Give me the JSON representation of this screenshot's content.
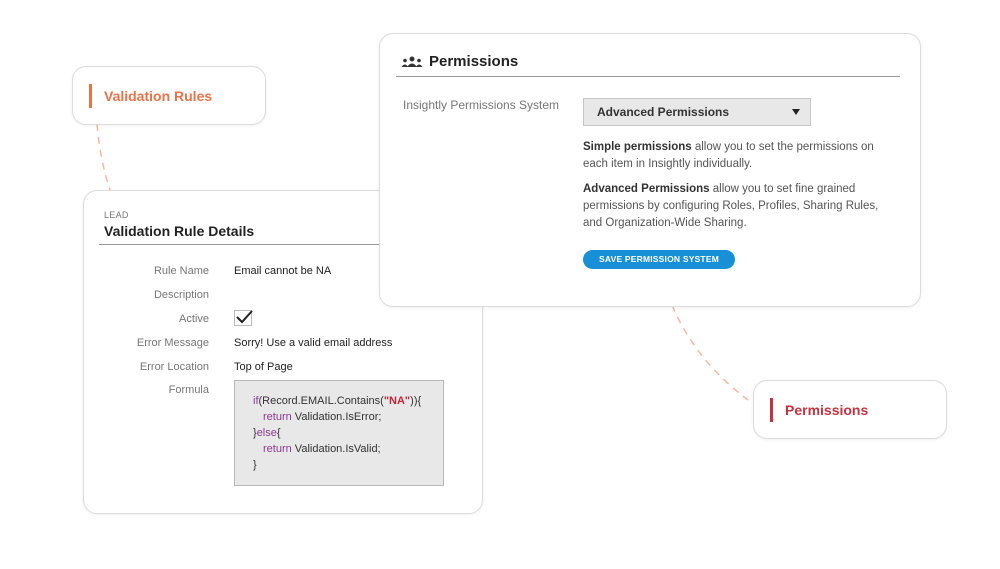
{
  "tags": {
    "validation_rules": "Validation Rules",
    "permissions": "Permissions"
  },
  "validation_card": {
    "subtitle": "LEAD",
    "title": "Validation Rule Details",
    "fields": [
      {
        "label": "Rule Name",
        "value": "Email cannot be NA"
      },
      {
        "label": "Description",
        "value": ""
      },
      {
        "label": "Active",
        "value": "checked"
      },
      {
        "label": "Error Message",
        "value": "Sorry! Use a valid email address"
      },
      {
        "label": "Error Location",
        "value": "Top of Page"
      },
      {
        "label": "Formula",
        "value": ""
      }
    ],
    "formula": {
      "line1_kw": "if",
      "line1_a": "(Record.EMAIL.Contains(",
      "line1_str": "\"NA\"",
      "line1_b": ")){",
      "line2_kw": "return",
      "line2_rest": " Validation.IsError;",
      "line3_a": "}",
      "line3_kw": "else",
      "line3_b": "{",
      "line4_kw": "return",
      "line4_rest": " Validation.IsValid;",
      "line5": "}"
    }
  },
  "permissions_card": {
    "icon": "users-icon",
    "title": "Permissions",
    "field_label": "Insightly Permissions System",
    "select_value": "Advanced Permissions",
    "para1_bold": "Simple permissions",
    "para1_rest": " allow you to set the permissions on each item in Insightly individually.",
    "para2_bold": "Advanced Permissions",
    "para2_rest": " allow you to set fine grained permissions by configuring Roles, Profiles, Sharing Rules, and Organization-Wide Sharing.",
    "save_button": "SAVE PERMISSION SYSTEM"
  },
  "colors": {
    "validation_accent": "#e8734a",
    "permissions_accent": "#c4333f",
    "button_blue": "#1890d8",
    "connector": "#f5b8a3"
  }
}
